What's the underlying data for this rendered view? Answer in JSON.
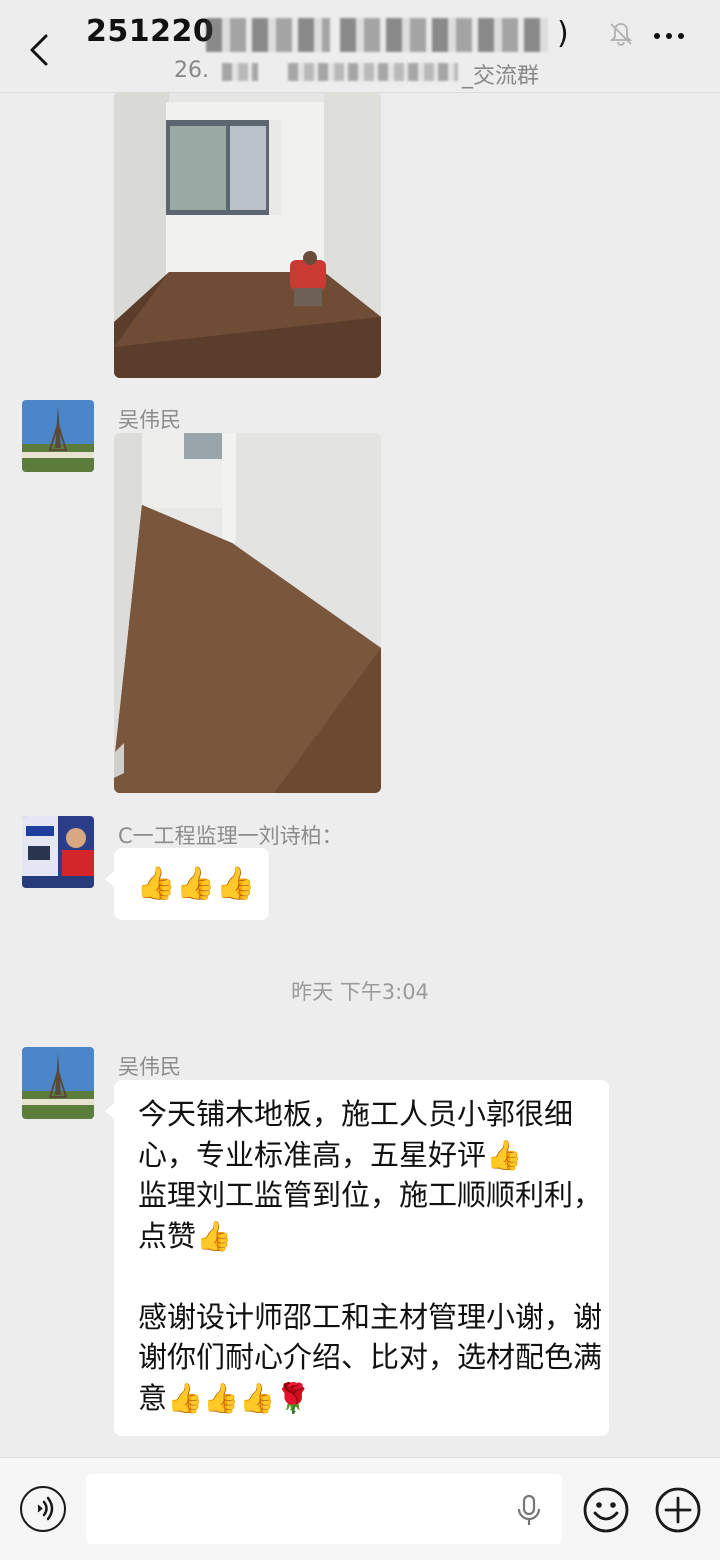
{
  "header": {
    "title_visible": "251220",
    "title_end": ")",
    "subtitle_start": "26.",
    "subtitle_end": "_交流群"
  },
  "messages": [
    {
      "type": "image",
      "sender": "",
      "scene": "room-with-window-and-worker"
    },
    {
      "type": "image",
      "sender": "吴伟民",
      "scene": "empty-room-wood-floor"
    },
    {
      "type": "text",
      "sender": "C一工程监理一刘诗柏：",
      "text": "👍👍👍"
    },
    {
      "type": "time",
      "text": "昨天 下午3:04"
    },
    {
      "type": "text",
      "sender": "吴伟民",
      "text": "今天铺木地板，施工人员小郭很细心，专业标准高，五星好评👍\n监理刘工监管到位，施工顺顺利利，点赞👍\n\n感谢设计师邵工和主材管理小谢，谢谢你们耐心介绍、比对，选材配色满意👍👍👍🌹"
    }
  ],
  "icons": {
    "back": "back-arrow-icon",
    "mute": "bell-mute-icon",
    "more": "more-dots-icon",
    "voice": "voice-icon",
    "mic": "microphone-icon",
    "emoji": "emoji-icon",
    "plus": "plus-icon"
  }
}
